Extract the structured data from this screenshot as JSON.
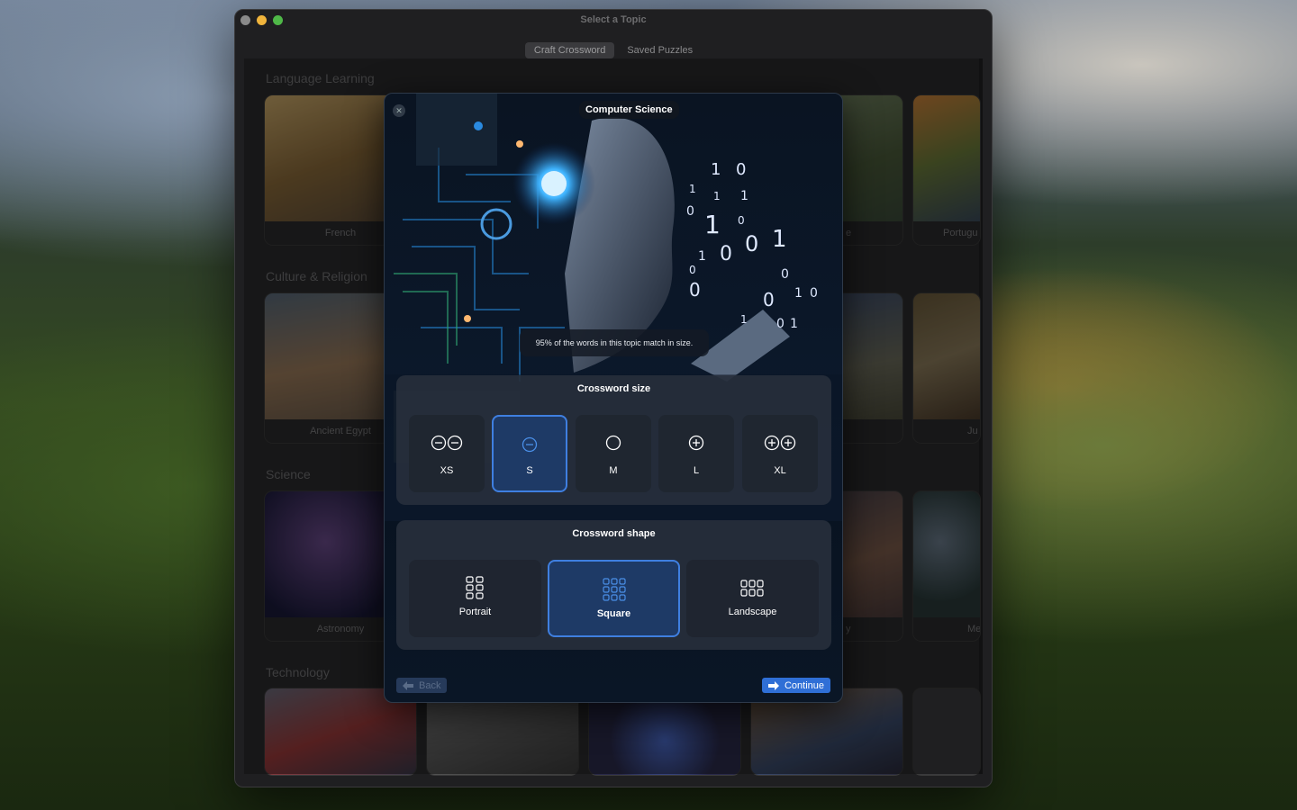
{
  "window": {
    "title": "Select a Topic",
    "tabs": [
      {
        "label": "Craft Crossword",
        "active": true
      },
      {
        "label": "Saved Puzzles",
        "active": false
      }
    ]
  },
  "sections": [
    {
      "title": "Language Learning",
      "cards": [
        "French",
        "",
        "",
        "e",
        "Portugu"
      ]
    },
    {
      "title": "Culture & Religion",
      "cards": [
        "Ancient Egypt",
        "",
        "",
        "",
        "Ju"
      ]
    },
    {
      "title": "Science",
      "cards": [
        "Astronomy",
        "",
        "",
        "y",
        "Me"
      ]
    },
    {
      "title": "Technology",
      "cards": [
        "",
        "",
        "",
        "",
        ""
      ]
    }
  ],
  "modal": {
    "topic": "Computer Science",
    "match_tip": "95% of the words in this topic match in size.",
    "size": {
      "title": "Crossword size",
      "options": [
        "XS",
        "S",
        "M",
        "L",
        "XL"
      ],
      "selected": "S"
    },
    "shape": {
      "title": "Crossword shape",
      "options": [
        "Portrait",
        "Square",
        "Landscape"
      ],
      "selected": "Square"
    },
    "back_label": "Back",
    "continue_label": "Continue"
  },
  "colors": {
    "accent": "#2f6fd6",
    "selected_border": "#3f7fe0"
  }
}
